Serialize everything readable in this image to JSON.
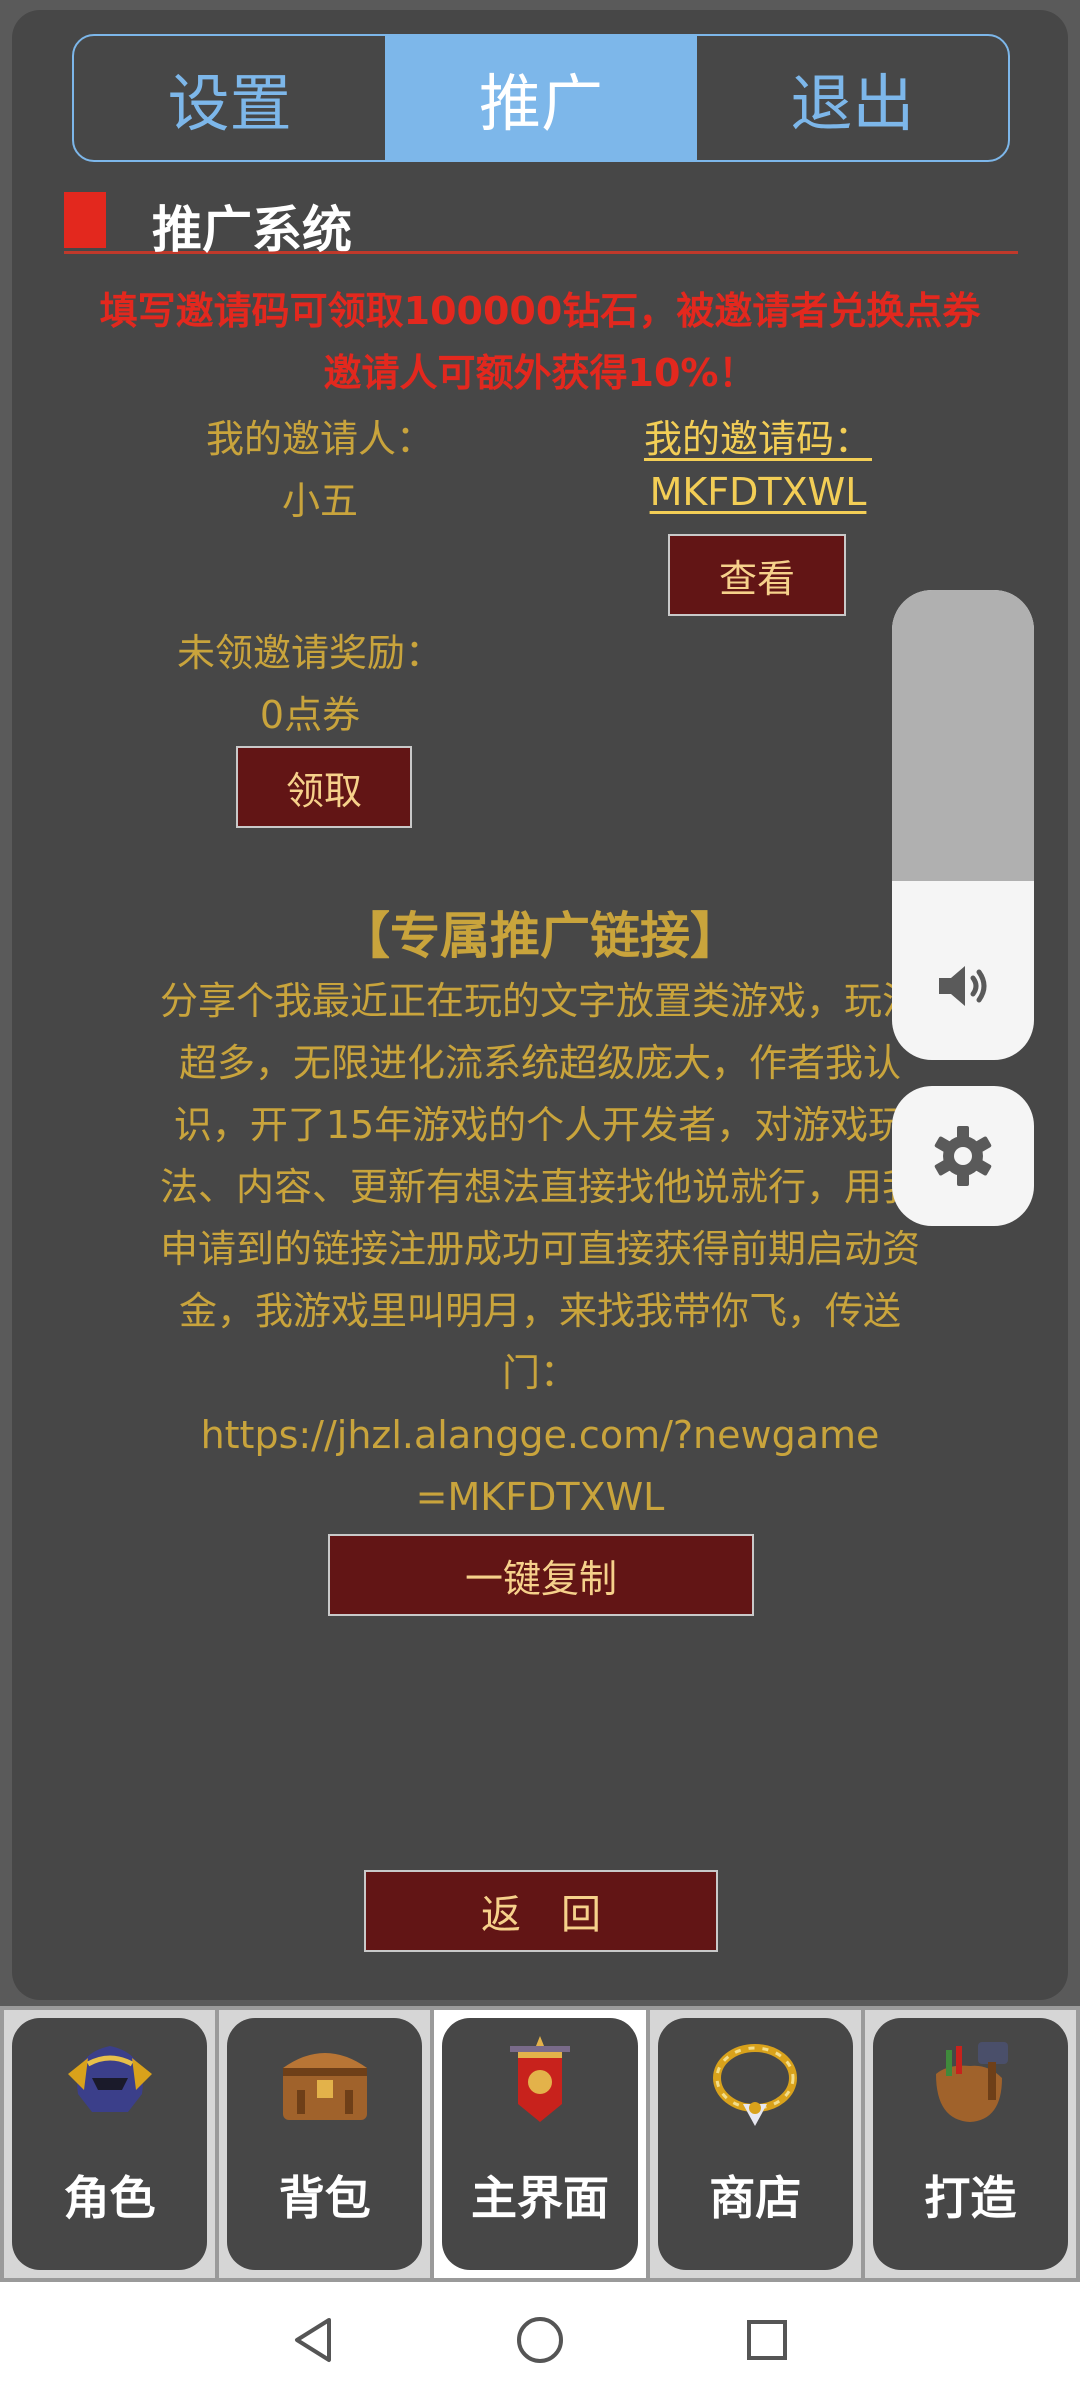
{
  "tabs": [
    {
      "label": "设置",
      "active": false
    },
    {
      "label": "推广",
      "active": true
    },
    {
      "label": "退出",
      "active": false
    }
  ],
  "section": {
    "title": "推广系统"
  },
  "notice": "填写邀请码可领取100000钻石，被邀请者兑换点券邀请人可额外获得10%！",
  "inviter": {
    "label": "我的邀请人：",
    "value": "小五"
  },
  "my_code": {
    "label": "我的邀请码：",
    "value": "MKFDTXWL",
    "button": "查看"
  },
  "reward": {
    "label": "未领邀请奖励：",
    "value": "0点券",
    "button": "领取"
  },
  "promo": {
    "title": "【专属推广链接】",
    "text": "分享个我最近正在玩的文字放置类游戏，玩法超多，无限进化流系统超级庞大，作者我认识，开了15年游戏的个人开发者，对游戏玩法、内容、更新有想法直接找他说就行，用我申请到的链接注册成功可直接获得前期启动资金，我游戏里叫明月，来找我带你飞，传送门：",
    "link": "https://jhzl.alangge.com/?newgame=MKFDTXWL",
    "copy_button": "一键复制"
  },
  "back_button": "返　回",
  "volume": {
    "level": 0.38,
    "icon": "speaker-icon"
  },
  "settings_icon": "gear-icon",
  "bottom_nav": [
    {
      "label": "角色",
      "icon": "helmet-icon",
      "active": false
    },
    {
      "label": "背包",
      "icon": "chest-icon",
      "active": false
    },
    {
      "label": "主界面",
      "icon": "banner-icon",
      "active": true
    },
    {
      "label": "商店",
      "icon": "necklace-icon",
      "active": false
    },
    {
      "label": "打造",
      "icon": "forge-bag-icon",
      "active": false
    }
  ],
  "colors": {
    "accent": "#7db7ea",
    "notice": "#e3281e",
    "gold": "#c9a43c",
    "button_bg": "#621515"
  }
}
